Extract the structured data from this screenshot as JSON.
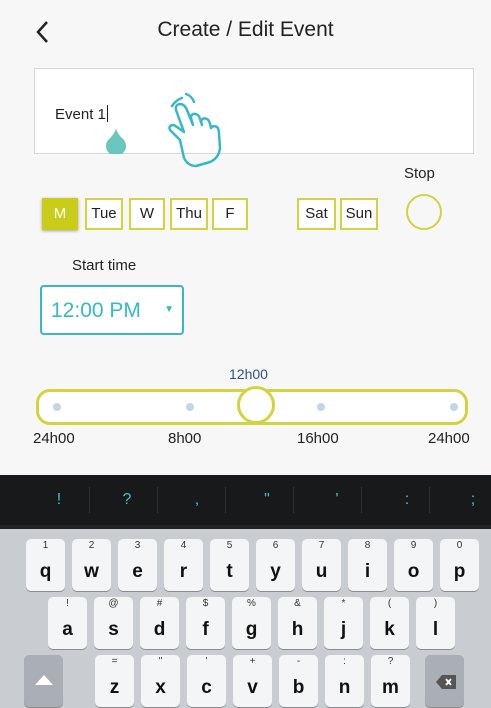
{
  "header": {
    "title": "Create / Edit Event",
    "back_icon": "chevron-left-icon"
  },
  "event_name": {
    "value": "Event 1"
  },
  "days": [
    {
      "label": "M",
      "selected": true
    },
    {
      "label": "Tue",
      "selected": false
    },
    {
      "label": "W",
      "selected": false
    },
    {
      "label": "Thu",
      "selected": false
    },
    {
      "label": "F",
      "selected": false
    },
    {
      "label": "Sat",
      "selected": false
    },
    {
      "label": "Sun",
      "selected": false
    }
  ],
  "stop": {
    "label": "Stop"
  },
  "start_time": {
    "label": "Start time",
    "value": "12:00 PM"
  },
  "slider": {
    "current_label": "12h00",
    "scale_labels": [
      "24h00",
      "8h00",
      "16h00",
      "24h00"
    ]
  },
  "keyboard": {
    "suggestions": [
      "!",
      "?",
      ",",
      "\"",
      "'",
      ":",
      ";"
    ],
    "row1": [
      {
        "hint": "1",
        "key": "q"
      },
      {
        "hint": "2",
        "key": "w"
      },
      {
        "hint": "3",
        "key": "e"
      },
      {
        "hint": "4",
        "key": "r"
      },
      {
        "hint": "5",
        "key": "t"
      },
      {
        "hint": "6",
        "key": "y"
      },
      {
        "hint": "7",
        "key": "u"
      },
      {
        "hint": "8",
        "key": "i"
      },
      {
        "hint": "9",
        "key": "o"
      },
      {
        "hint": "0",
        "key": "p"
      }
    ],
    "row2": [
      {
        "hint": "!",
        "key": "a"
      },
      {
        "hint": "@",
        "key": "s"
      },
      {
        "hint": "#",
        "key": "d"
      },
      {
        "hint": "$",
        "key": "f"
      },
      {
        "hint": "%",
        "key": "g"
      },
      {
        "hint": "&",
        "key": "h"
      },
      {
        "hint": "*",
        "key": "j"
      },
      {
        "hint": "(",
        "key": "k"
      },
      {
        "hint": ")",
        "key": "l"
      }
    ],
    "row3": [
      {
        "hint": "=",
        "key": "z"
      },
      {
        "hint": "\"",
        "key": "x"
      },
      {
        "hint": "'",
        "key": "c"
      },
      {
        "hint": "+",
        "key": "v"
      },
      {
        "hint": "-",
        "key": "b"
      },
      {
        "hint": ":",
        "key": "n"
      },
      {
        "hint": "?",
        "key": "m"
      }
    ]
  },
  "colors": {
    "accent_yellow": "#c9cc18",
    "accent_teal": "#35b9c4",
    "slider_label": "#2f4f8a"
  }
}
